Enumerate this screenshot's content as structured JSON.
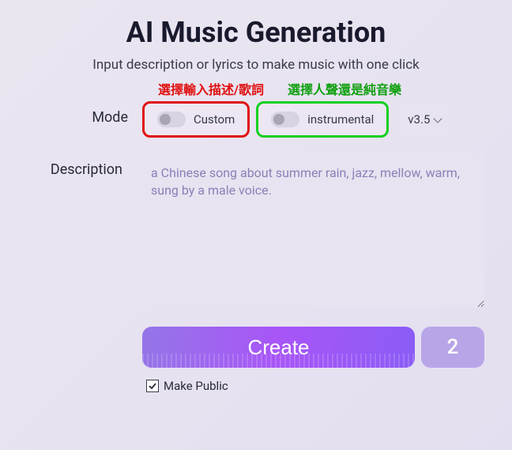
{
  "title": "AI Music Generation",
  "subtitle": "Input description or lyrics to make music with one click",
  "annotations": {
    "red": "選擇輸入描述/歌詞",
    "green": "選擇人聲還是純音樂"
  },
  "mode": {
    "label": "Mode",
    "custom_toggle_label": "Custom",
    "instrumental_toggle_label": "instrumental",
    "version": "v3.5"
  },
  "description": {
    "label": "Description",
    "placeholder": "a Chinese song about summer rain, jazz, mellow, warm, sung by a male voice."
  },
  "actions": {
    "create_label": "Create",
    "count": "2",
    "make_public_label": "Make Public"
  }
}
